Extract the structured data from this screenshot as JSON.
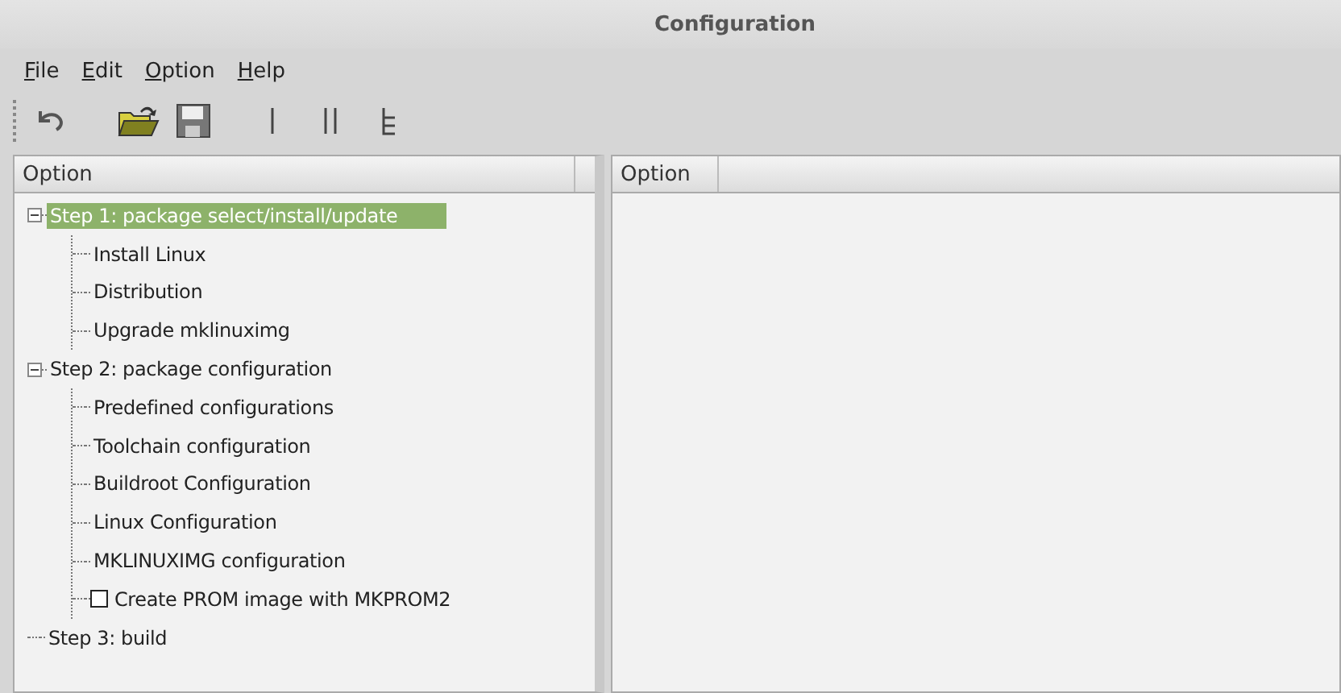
{
  "window": {
    "title": "Configuration"
  },
  "menu": [
    "File",
    "Edit",
    "Option",
    "Help"
  ],
  "left_panel": {
    "columns": [
      "Option"
    ],
    "tree": [
      {
        "label": "Step 1: package select/install/update",
        "selected": true,
        "expanded": true,
        "children": [
          {
            "label": "Install Linux",
            "selected": false
          },
          {
            "label": "Distribution",
            "selected": false
          },
          {
            "label": "Upgrade mklinuximg",
            "selected": false
          }
        ]
      },
      {
        "label": "Step 2: package configuration",
        "selected": false,
        "expanded": true,
        "children": [
          {
            "label": "Predefined configurations",
            "selected": false
          },
          {
            "label": "Toolchain configuration",
            "selected": false
          },
          {
            "label": "Buildroot Configuration",
            "selected": false
          },
          {
            "label": "Linux Configuration",
            "selected": false
          },
          {
            "label": "MKLINUXIMG configuration",
            "selected": false
          },
          {
            "label": "Create PROM image with MKPROM2",
            "selected": false,
            "kind": "checkbox",
            "checked": false
          }
        ]
      },
      {
        "label": "Step 3: build",
        "selected": false
      }
    ]
  },
  "right_panel": {
    "columns": [
      "Option"
    ]
  }
}
